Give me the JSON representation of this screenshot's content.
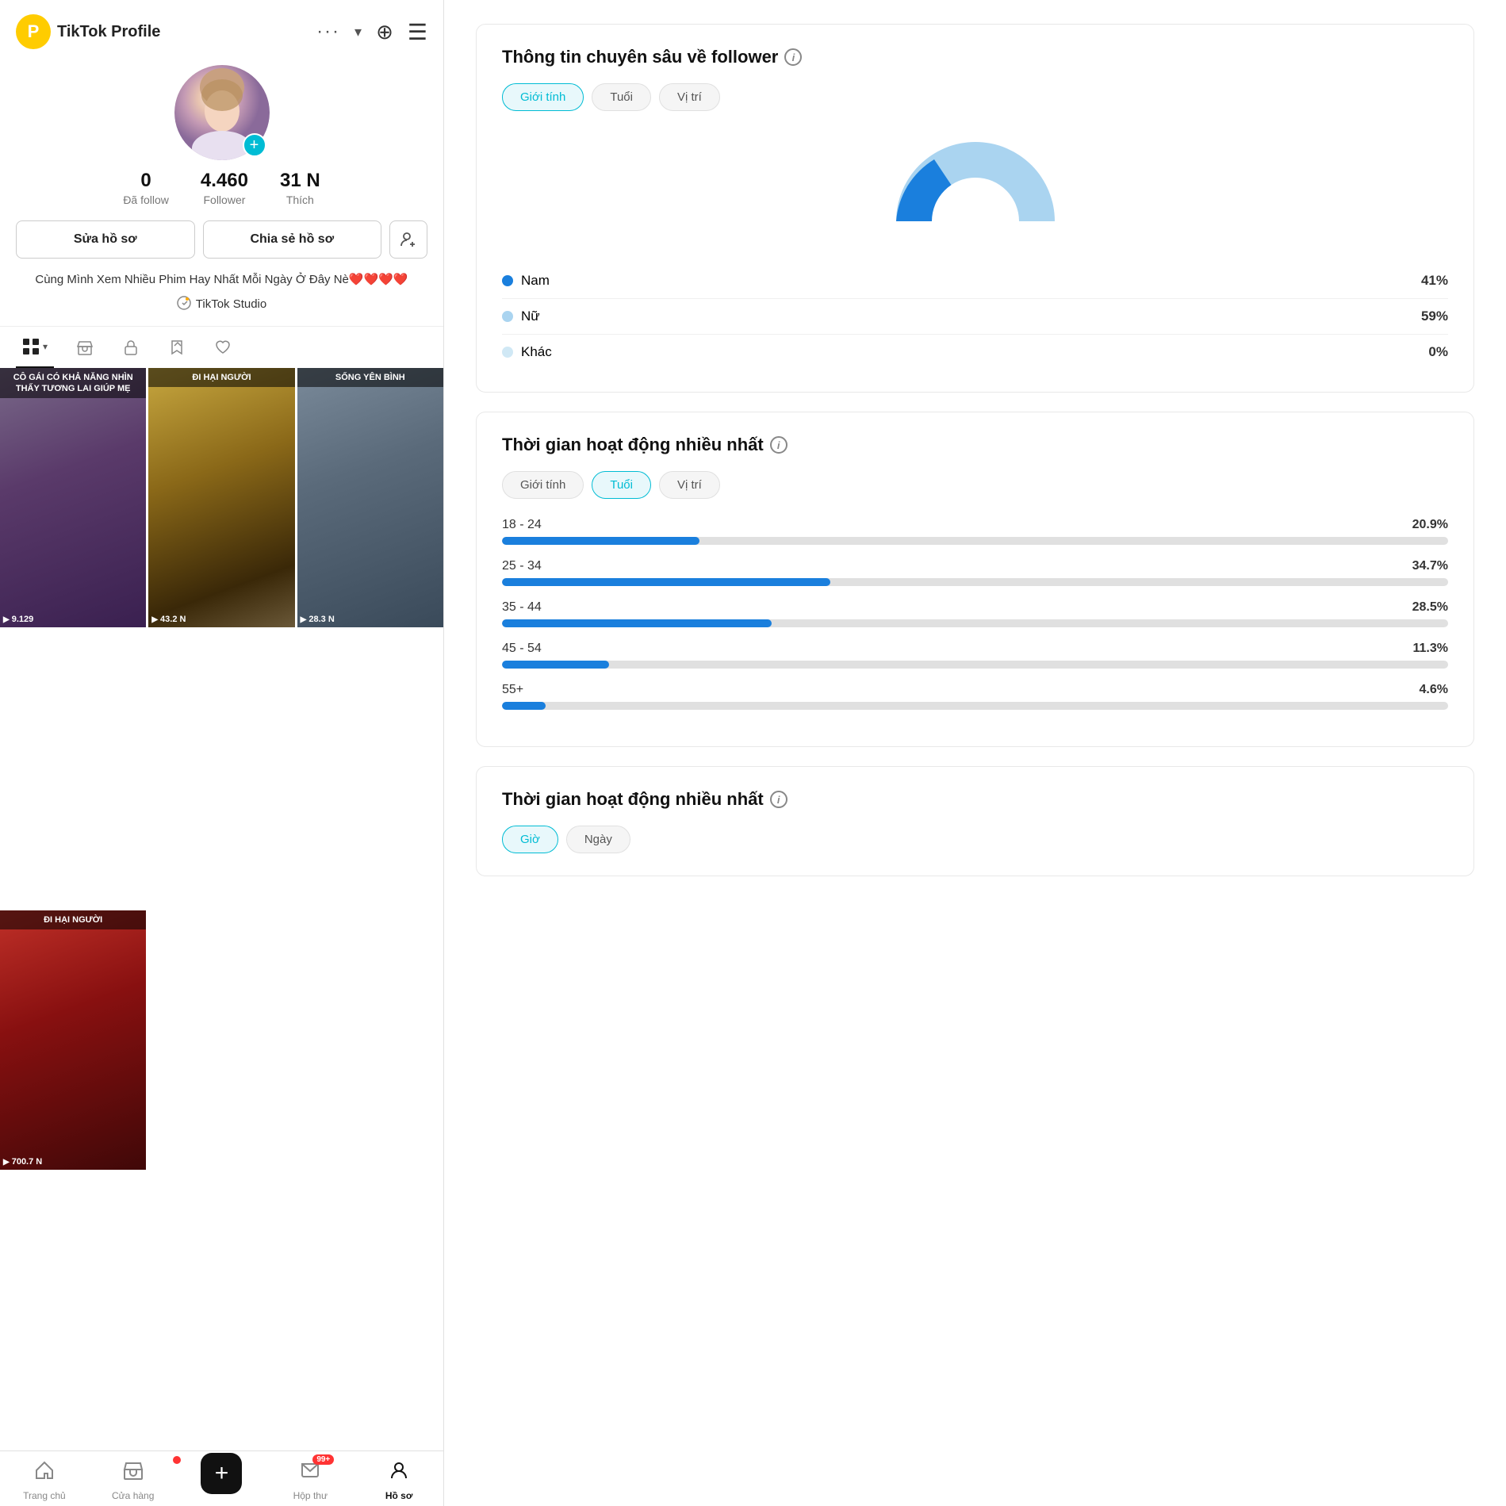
{
  "app": {
    "title": "TikTok Profile"
  },
  "left": {
    "nav": {
      "p_label": "P",
      "username": "...",
      "dots": "...",
      "dropdown": "▾"
    },
    "profile": {
      "username": "",
      "stats": {
        "follow": {
          "num": "0",
          "label": "Đã follow"
        },
        "follower": {
          "num": "4.460",
          "label": "Follower"
        },
        "thich": {
          "num": "31 N",
          "label": "Thích"
        }
      },
      "btn_edit": "Sửa hồ sơ",
      "btn_share": "Chia sẻ hồ sơ",
      "bio": "Cùng Mình Xem Nhiều Phim Hay Nhất Mỗi Ngày Ở Đây Nè❤️❤️❤️❤️",
      "tiktok_studio": "TikTok Studio"
    },
    "videos": [
      {
        "banner": "CÔ GÁI CÓ KHẢ NĂNG NHÌN THẤY TƯƠNG LAI GIÚP MẸ",
        "stats": "9.129",
        "color_class": "v1"
      },
      {
        "banner": "ĐI HẠI NGƯỜI",
        "stats": "43.2 N",
        "color_class": "v2"
      },
      {
        "banner": "SỐNG YÊN BÌNH",
        "stats": "28.3 N",
        "color_class": "v3"
      },
      {
        "banner": "ĐI HẠI NGƯỜI",
        "stats": "700.7 N",
        "color_class": "v4"
      }
    ],
    "bottom_nav": [
      {
        "label": "Trang chủ",
        "icon": "🏠",
        "active": false
      },
      {
        "label": "Cửa hàng",
        "icon": "🛍️",
        "active": false
      },
      {
        "label": "+",
        "icon": "+",
        "active": false,
        "center": true
      },
      {
        "label": "Hộp thư",
        "icon": "💬",
        "active": false,
        "badge": "99+"
      },
      {
        "label": "Hồ sơ",
        "icon": "👤",
        "active": true
      }
    ]
  },
  "right": {
    "section1": {
      "title": "Thông tin chuyên sâu về follower",
      "filter_tabs": [
        {
          "label": "Giới tính",
          "active": true
        },
        {
          "label": "Tuổi",
          "active": false
        },
        {
          "label": "Vị trí",
          "active": false
        }
      ],
      "chart": {
        "nam_pct": 41,
        "nu_pct": 59,
        "khac_pct": 0
      },
      "gender_rows": [
        {
          "label": "Nam",
          "color": "#1a7fdd",
          "pct": "41%"
        },
        {
          "label": "Nữ",
          "color": "#aad4f0",
          "pct": "59%"
        },
        {
          "label": "Khác",
          "color": "#d0e8f5",
          "pct": "0%"
        }
      ]
    },
    "section2": {
      "title": "Thời gian hoạt động nhiều nhất",
      "filter_tabs": [
        {
          "label": "Giới tính",
          "active": false
        },
        {
          "label": "Tuổi",
          "active": true
        },
        {
          "label": "Vị trí",
          "active": false
        }
      ],
      "age_bars": [
        {
          "range": "18 - 24",
          "pct_label": "20.9%",
          "pct_val": 20.9
        },
        {
          "range": "25 - 34",
          "pct_label": "34.7%",
          "pct_val": 34.7
        },
        {
          "range": "35 - 44",
          "pct_label": "28.5%",
          "pct_val": 28.5
        },
        {
          "range": "45 - 54",
          "pct_label": "11.3%",
          "pct_val": 11.3
        },
        {
          "range": "55+",
          "pct_label": "4.6%",
          "pct_val": 4.6
        }
      ]
    },
    "section3": {
      "title": "Thời gian hoạt động nhiều nhất",
      "filter_tabs": [
        {
          "label": "Giờ",
          "active": true
        },
        {
          "label": "Ngày",
          "active": false
        }
      ]
    }
  }
}
